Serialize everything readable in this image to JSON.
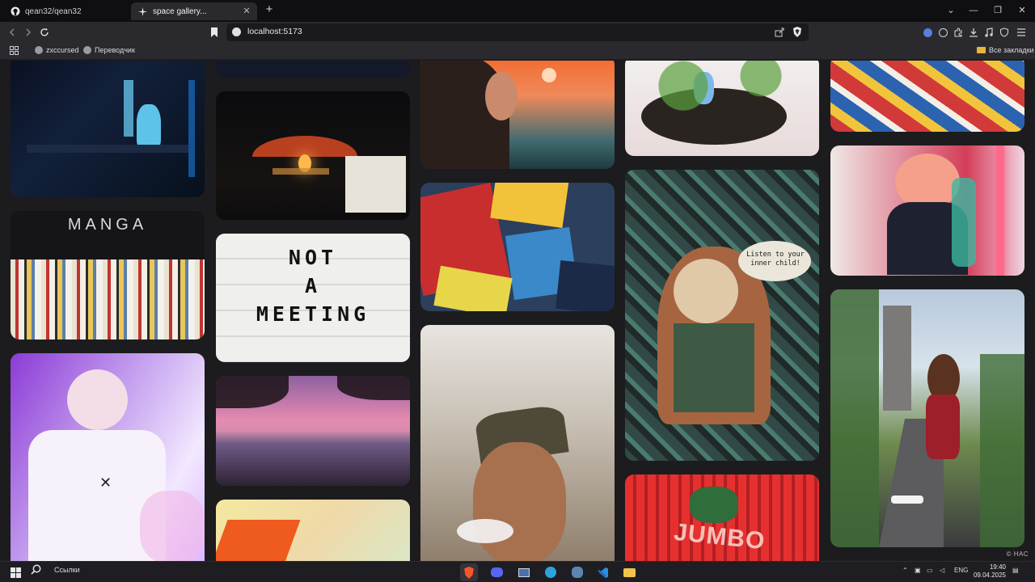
{
  "tabs": [
    {
      "label": "qean32/qean32",
      "icon": "github-icon"
    },
    {
      "label": "space gallery...",
      "icon": "sparkle-icon",
      "active": true
    }
  ],
  "address": {
    "url": "localhost:5173"
  },
  "bookmarks": [
    {
      "label": "zxccursed"
    },
    {
      "label": "Переводчик"
    }
  ],
  "bookmarks_all": "Все закладки",
  "gallery": {
    "photos": [
      {
        "id": "pc-figure",
        "text": ""
      },
      {
        "id": "manga-shelf",
        "text": "MANGA"
      },
      {
        "id": "neon-portrait",
        "text": ""
      },
      {
        "id": "dark-top",
        "text": ""
      },
      {
        "id": "lamp-bar",
        "text": ""
      },
      {
        "id": "lightbox-sign",
        "text": "NOT\nA\nMEETING"
      },
      {
        "id": "pink-beach",
        "text": ""
      },
      {
        "id": "orange-chair",
        "text": ""
      },
      {
        "id": "sunset-woman",
        "text": ""
      },
      {
        "id": "comics-pile",
        "text": ""
      },
      {
        "id": "old-man-smoke",
        "text": ""
      },
      {
        "id": "plant-figure",
        "text": ""
      },
      {
        "id": "graffiti-lady",
        "text": "Listen to your inner child!"
      },
      {
        "id": "neon-sign-red",
        "text": "JUMBO"
      },
      {
        "id": "comics-strip",
        "text": ""
      },
      {
        "id": "kirby-camera",
        "text": ""
      },
      {
        "id": "castle-girl",
        "text": ""
      }
    ],
    "watermark": "© НАС"
  },
  "taskbar": {
    "search_label": "Ссылки",
    "lang": "ENG",
    "time": "19:40",
    "date": "09.04.2025"
  },
  "colors": {
    "background": "#1c1c1e",
    "accent": "#0a84ff"
  }
}
